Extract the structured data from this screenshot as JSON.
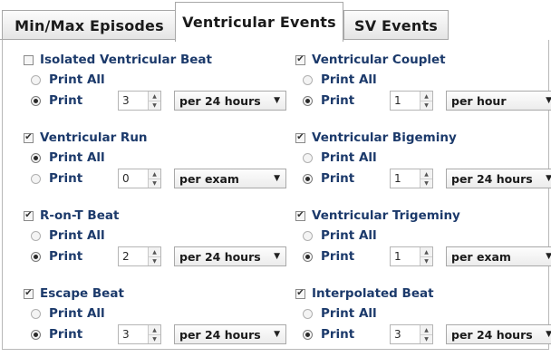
{
  "tabs": [
    {
      "label": "Min/Max Episodes",
      "active": false
    },
    {
      "label": "Ventricular Events",
      "active": true
    },
    {
      "label": "SV Events",
      "active": false
    }
  ],
  "groups": [
    {
      "title": "Isolated Ventricular Beat",
      "checked": false,
      "print_all_label": "Print All",
      "print_label": "Print",
      "selected": "print",
      "count": "3",
      "period": "per 24 hours"
    },
    {
      "title": "Ventricular Couplet",
      "checked": true,
      "print_all_label": "Print All",
      "print_label": "Print",
      "selected": "print",
      "count": "1",
      "period": "per hour"
    },
    {
      "title": "Ventricular Run",
      "checked": true,
      "print_all_label": "Print All",
      "print_label": "Print",
      "selected": "print_all",
      "count": "0",
      "period": "per exam"
    },
    {
      "title": "Ventricular Bigeminy",
      "checked": true,
      "print_all_label": "Print All",
      "print_label": "Print",
      "selected": "print",
      "count": "1",
      "period": "per 24 hours"
    },
    {
      "title": "R-on-T Beat",
      "checked": true,
      "print_all_label": "Print All",
      "print_label": "Print",
      "selected": "print",
      "count": "2",
      "period": "per 24 hours"
    },
    {
      "title": "Ventricular Trigeminy",
      "checked": true,
      "print_all_label": "Print All",
      "print_label": "Print",
      "selected": "print",
      "count": "1",
      "period": "per exam"
    },
    {
      "title": "Escape Beat",
      "checked": true,
      "print_all_label": "Print All",
      "print_label": "Print",
      "selected": "print",
      "count": "3",
      "period": "per 24 hours"
    },
    {
      "title": "Interpolated Beat",
      "checked": true,
      "print_all_label": "Print All",
      "print_label": "Print",
      "selected": "print",
      "count": "3",
      "period": "per 24 hours"
    }
  ],
  "icons": {
    "checkbox_check": "checkmark-icon",
    "spin_up": "caret-up-icon",
    "spin_down": "caret-down-icon",
    "dropdown": "caret-down-icon"
  },
  "colors": {
    "label_text": "#1c3a6b",
    "tab_text": "#1a1a1a"
  }
}
